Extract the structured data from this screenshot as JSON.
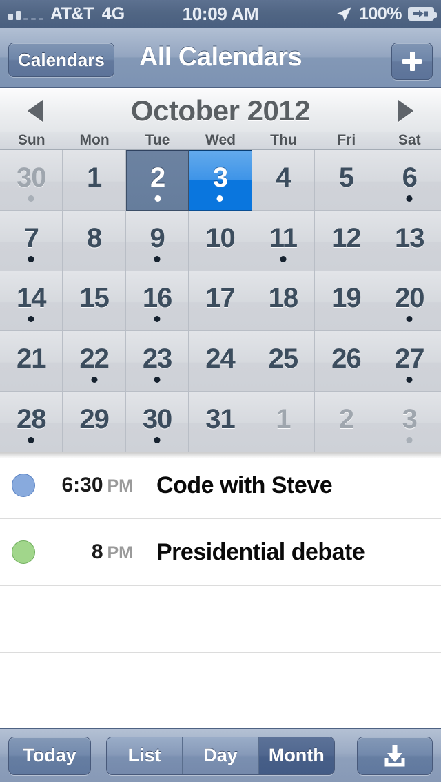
{
  "status_bar": {
    "carrier": "AT&T",
    "network": "4G",
    "time": "10:09 AM",
    "battery_percent": "100%",
    "signal_bars_filled": 2,
    "signal_bars_total": 5,
    "location_icon": "location-arrow-icon",
    "battery_icon": "battery-charging-icon"
  },
  "nav_bar": {
    "back_label": "Calendars",
    "title": "All Calendars",
    "add_icon": "plus-icon"
  },
  "month_header": {
    "title": "October 2012",
    "prev_icon": "triangle-left-icon",
    "next_icon": "triangle-right-icon"
  },
  "weekdays": [
    "Sun",
    "Mon",
    "Tue",
    "Wed",
    "Thu",
    "Fri",
    "Sat"
  ],
  "calendar": {
    "month": "October",
    "year": "2012",
    "selected_day": 2,
    "today_day": 3,
    "weeks": [
      [
        {
          "n": "30",
          "other": true,
          "dot": true,
          "state": "normal"
        },
        {
          "n": "1",
          "other": false,
          "dot": false,
          "state": "normal"
        },
        {
          "n": "2",
          "other": false,
          "dot": true,
          "state": "selected"
        },
        {
          "n": "3",
          "other": false,
          "dot": true,
          "state": "today"
        },
        {
          "n": "4",
          "other": false,
          "dot": false,
          "state": "normal"
        },
        {
          "n": "5",
          "other": false,
          "dot": false,
          "state": "normal"
        },
        {
          "n": "6",
          "other": false,
          "dot": true,
          "state": "normal"
        }
      ],
      [
        {
          "n": "7",
          "other": false,
          "dot": true,
          "state": "normal"
        },
        {
          "n": "8",
          "other": false,
          "dot": false,
          "state": "normal"
        },
        {
          "n": "9",
          "other": false,
          "dot": true,
          "state": "normal"
        },
        {
          "n": "10",
          "other": false,
          "dot": false,
          "state": "normal"
        },
        {
          "n": "11",
          "other": false,
          "dot": true,
          "state": "normal"
        },
        {
          "n": "12",
          "other": false,
          "dot": false,
          "state": "normal"
        },
        {
          "n": "13",
          "other": false,
          "dot": false,
          "state": "normal"
        }
      ],
      [
        {
          "n": "14",
          "other": false,
          "dot": true,
          "state": "normal"
        },
        {
          "n": "15",
          "other": false,
          "dot": false,
          "state": "normal"
        },
        {
          "n": "16",
          "other": false,
          "dot": true,
          "state": "normal"
        },
        {
          "n": "17",
          "other": false,
          "dot": false,
          "state": "normal"
        },
        {
          "n": "18",
          "other": false,
          "dot": false,
          "state": "normal"
        },
        {
          "n": "19",
          "other": false,
          "dot": false,
          "state": "normal"
        },
        {
          "n": "20",
          "other": false,
          "dot": true,
          "state": "normal"
        }
      ],
      [
        {
          "n": "21",
          "other": false,
          "dot": false,
          "state": "normal"
        },
        {
          "n": "22",
          "other": false,
          "dot": true,
          "state": "normal"
        },
        {
          "n": "23",
          "other": false,
          "dot": true,
          "state": "normal"
        },
        {
          "n": "24",
          "other": false,
          "dot": false,
          "state": "normal"
        },
        {
          "n": "25",
          "other": false,
          "dot": false,
          "state": "normal"
        },
        {
          "n": "26",
          "other": false,
          "dot": false,
          "state": "normal"
        },
        {
          "n": "27",
          "other": false,
          "dot": true,
          "state": "normal"
        }
      ],
      [
        {
          "n": "28",
          "other": false,
          "dot": true,
          "state": "normal"
        },
        {
          "n": "29",
          "other": false,
          "dot": false,
          "state": "normal"
        },
        {
          "n": "30",
          "other": false,
          "dot": true,
          "state": "normal"
        },
        {
          "n": "31",
          "other": false,
          "dot": false,
          "state": "normal"
        },
        {
          "n": "1",
          "other": true,
          "dot": false,
          "state": "normal"
        },
        {
          "n": "2",
          "other": true,
          "dot": false,
          "state": "normal"
        },
        {
          "n": "3",
          "other": true,
          "dot": true,
          "state": "normal"
        }
      ]
    ]
  },
  "events": [
    {
      "time": "6:30",
      "ampm": "PM",
      "title": "Code with Steve",
      "color": "#88aadd",
      "swatch": "blue"
    },
    {
      "time": "8",
      "ampm": "PM",
      "title": "Presidential debate",
      "color": "#a1d68b",
      "swatch": "green"
    }
  ],
  "empty_rows": 2,
  "toolbar": {
    "today_label": "Today",
    "segments": [
      {
        "label": "List",
        "active": false
      },
      {
        "label": "Day",
        "active": false
      },
      {
        "label": "Month",
        "active": true
      }
    ],
    "export_icon": "download-icon"
  },
  "colors": {
    "accent_today": "#0a76de",
    "accent_selected": "#69809f",
    "navbar": "#8398b6",
    "grid_bg": "#d6d9de"
  }
}
